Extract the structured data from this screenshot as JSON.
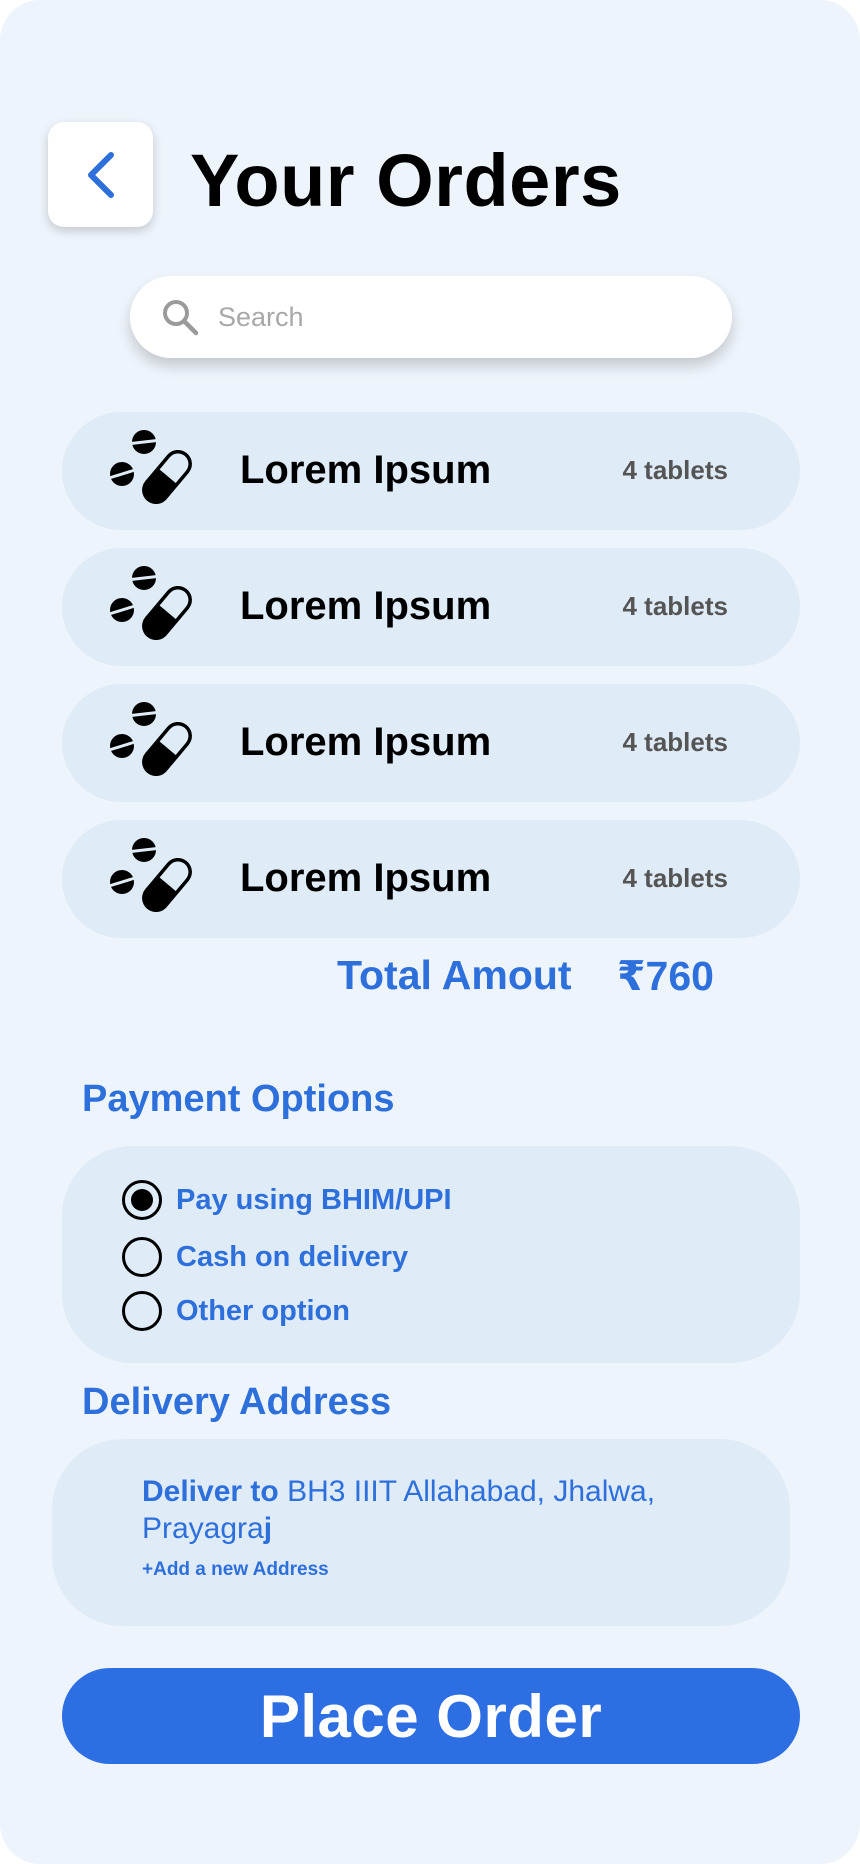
{
  "header": {
    "title": "Your Orders",
    "back_icon": "chevron-left-icon"
  },
  "search": {
    "placeholder": "Search",
    "value": ""
  },
  "orders": [
    {
      "name": "Lorem Ipsum",
      "quantity": "4 tablets",
      "icon": "pills-icon"
    },
    {
      "name": "Lorem Ipsum",
      "quantity": "4 tablets",
      "icon": "pills-icon"
    },
    {
      "name": "Lorem Ipsum",
      "quantity": "4 tablets",
      "icon": "pills-icon"
    },
    {
      "name": "Lorem Ipsum",
      "quantity": "4 tablets",
      "icon": "pills-icon"
    }
  ],
  "total": {
    "label": "Total Amout",
    "value": "₹760"
  },
  "payment": {
    "title": "Payment Options",
    "options": [
      {
        "label": "Pay using BHIM/UPI",
        "selected": true
      },
      {
        "label": "Cash on delivery",
        "selected": false
      },
      {
        "label": "Other option",
        "selected": false
      }
    ]
  },
  "delivery": {
    "title": "Delivery Address",
    "prefix": "Deliver to",
    "address": "BH3 IIIT Allahabad, Jhalwa, Prayagra",
    "address_end": "j",
    "add_link": "+Add a new Address"
  },
  "cta": {
    "label": "Place Order"
  },
  "colors": {
    "accent": "#2d6fdb",
    "background": "#eef4fb",
    "card": "#dfebf7",
    "button": "#2d6fe3"
  }
}
